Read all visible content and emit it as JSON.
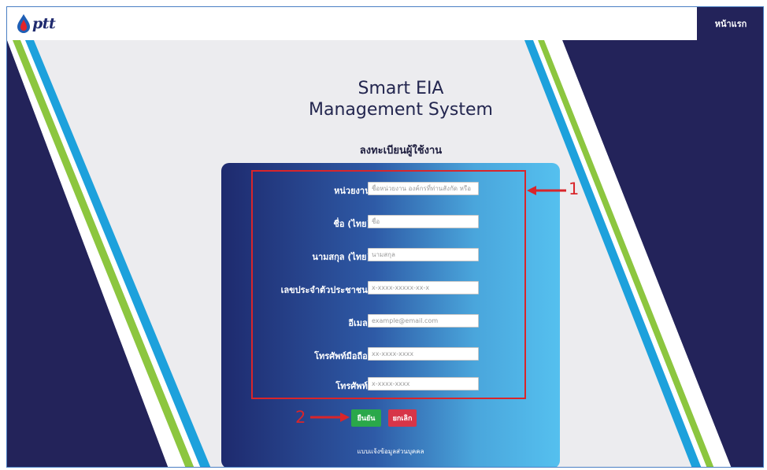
{
  "header": {
    "brand": "ptt",
    "home_label": "หน้าแรก"
  },
  "page": {
    "title_line1": "Smart EIA",
    "title_line2": "Management System",
    "subtitle": "ลงทะเบียนผู้ใช้งาน"
  },
  "form": {
    "fields": [
      {
        "label": "หน่วยงาน:",
        "placeholder": "ชื่อหน่วยงาน องค์กรที่ท่านสังกัด หรือ"
      },
      {
        "label": "ชื่อ (ไทย):",
        "placeholder": "ชื่อ"
      },
      {
        "label": "นามสกุล (ไทย):",
        "placeholder": "นามสกุล"
      },
      {
        "label": "เลขประจำตัวประชาชน :",
        "placeholder": "x-xxxx-xxxxx-xx-x"
      },
      {
        "label": "อีเมล :",
        "placeholder": "example@email.com"
      },
      {
        "label": "โทรศัพท์มือถือ :",
        "placeholder": "xx-xxxx-xxxx"
      },
      {
        "label": "โทรศัพท์ :",
        "placeholder": "x-xxxx-xxxx"
      }
    ],
    "confirm_label": "ยืนยัน",
    "cancel_label": "ยกเลิก",
    "privacy_link": "แบบแจ้งข้อมูลส่วนบุคคล"
  },
  "annotations": {
    "marker1": "1",
    "marker2": "2"
  },
  "colors": {
    "navy": "#23235a",
    "green_stripe": "#8cc63f",
    "blue_stripe": "#1da1dc",
    "annotation_red": "#d9252a"
  }
}
